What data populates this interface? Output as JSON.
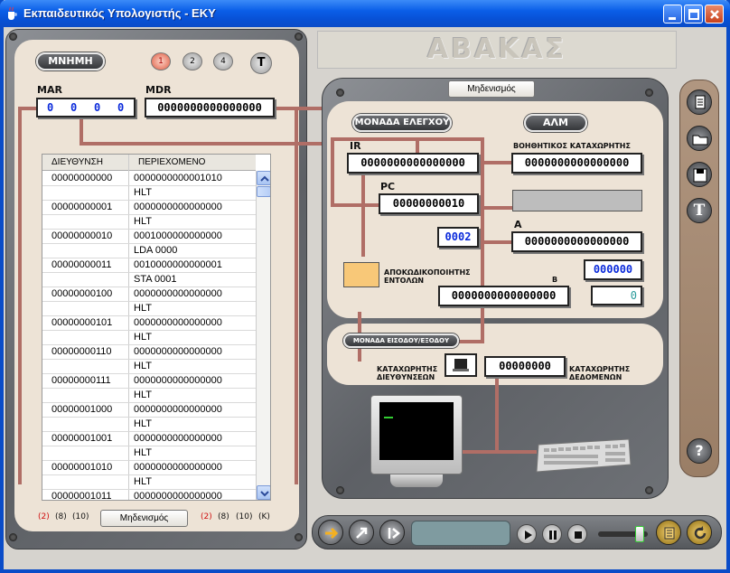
{
  "window": {
    "title": "Εκπαιδευτικός Υπολογιστής - ΕΚΥ"
  },
  "memory": {
    "title": "ΜΝΗΜΗ",
    "tabs": [
      "1",
      "2",
      "4"
    ],
    "text_tab": "T",
    "mar_label": "MAR",
    "mar_digits": [
      "0",
      "0",
      "0",
      "0"
    ],
    "mdr_label": "MDR",
    "mdr_value": "0000000000000000",
    "table": {
      "headers": [
        "ΔΙΕΥΘΥΝΣΗ",
        "ΠΕΡΙΕΧΟΜΕΝΟ"
      ],
      "rows": [
        [
          "00000000000",
          "0000000000001010"
        ],
        [
          "",
          "HLT"
        ],
        [
          "00000000001",
          "0000000000000000"
        ],
        [
          "",
          "HLT"
        ],
        [
          "00000000010",
          "0001000000000000"
        ],
        [
          "",
          "LDA   0000"
        ],
        [
          "00000000011",
          "0010000000000001"
        ],
        [
          "",
          "STA   0001"
        ],
        [
          "00000000100",
          "0000000000000000"
        ],
        [
          "",
          "HLT"
        ],
        [
          "00000000101",
          "0000000000000000"
        ],
        [
          "",
          "HLT"
        ],
        [
          "00000000110",
          "0000000000000000"
        ],
        [
          "",
          "HLT"
        ],
        [
          "00000000111",
          "0000000000000000"
        ],
        [
          "",
          "HLT"
        ],
        [
          "00000001000",
          "0000000000000000"
        ],
        [
          "",
          "HLT"
        ],
        [
          "00000001001",
          "0000000000000000"
        ],
        [
          "",
          "HLT"
        ],
        [
          "00000001010",
          "0000000000000000"
        ],
        [
          "",
          "HLT"
        ],
        [
          "00000001011",
          "0000000000000000"
        ]
      ]
    },
    "address_radix": [
      "(2)",
      "(8)",
      "(10)"
    ],
    "content_radix": [
      "(2)",
      "(8)",
      "(10)",
      "(K)"
    ],
    "reset_label": "Μηδενισμός"
  },
  "logo_text": "ΑΒΑΚΑΣ",
  "cpu": {
    "reset_label": "Μηδενισμός",
    "control_unit_label": "ΜΟΝΑΔΑ ΕΛΕΓΧΟΥ",
    "alu_label": "ΑΛΜ",
    "ir_label": "IR",
    "ir_value": "0000000000000000",
    "pc_label": "PC",
    "pc_value": "00000000010",
    "pc_decimal": "0002",
    "decoder_label_1": "ΑΠΟΚΩΔΙΚΟΠΟΙΗΤΗΣ",
    "decoder_label_2": "ΕΝΤΟΛΩΝ",
    "aux_label": "ΒΟΗΘΗΤΙΚΟΣ ΚΑΤΑΧΩΡΗΤΗΣ",
    "aux_value": "0000000000000000",
    "a_label": "A",
    "a_value": "0000000000000000",
    "a_decimal": "000000",
    "b_label": "B",
    "b_value": "0000000000000000",
    "flag_value": "0"
  },
  "io": {
    "label": "ΜΟΝΑΔΑ ΕΙΣΟΔΟΥ/ΕΞΟΔΟΥ",
    "addr_reg_label_1": "ΚΑΤΑΧΩΡΗΤΗΣ",
    "addr_reg_label_2": "ΔΙΕΥΘΥΝΣΕΩΝ",
    "data_reg_label_1": "ΚΑΤΑΧΩΡΗΤΗΣ",
    "data_reg_label_2": "ΔΕΔΟΜΕΝΩΝ",
    "data_value": "00000000"
  },
  "sidebar": {
    "icons": [
      "new-document-icon",
      "open-folder-icon",
      "save-disk-icon",
      "text-icon",
      "help-icon"
    ],
    "text_icon_label": "T",
    "help_label": "?"
  },
  "colors": {
    "titlebar": "#0a5ee8",
    "wire": "#b06e66",
    "panel": "#ede3d6",
    "register_blue": "#0a2adb",
    "radix_selected": "#d01010",
    "decoder_fill": "#f8c878"
  }
}
